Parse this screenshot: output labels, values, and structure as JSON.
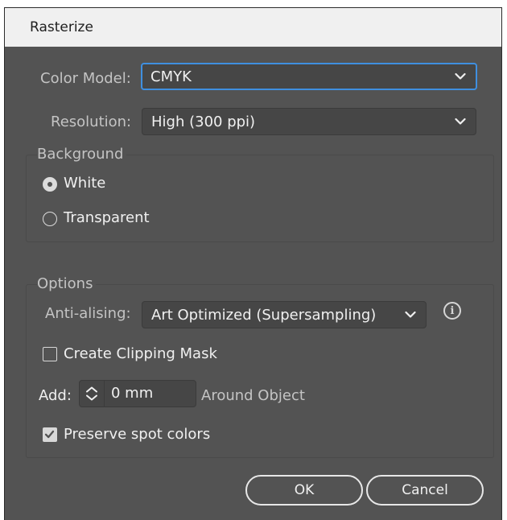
{
  "dialog": {
    "title": "Rasterize",
    "color_model": {
      "label": "Color Model:",
      "value": "CMYK"
    },
    "resolution": {
      "label": "Resolution:",
      "value": "High (300 ppi)"
    },
    "background": {
      "title": "Background",
      "options": [
        "White",
        "Transparent"
      ],
      "selected": "White"
    },
    "options": {
      "title": "Options",
      "anti_aliasing": {
        "label": "Anti-alising:",
        "value": "Art Optimized (Supersampling)"
      },
      "create_clipping_mask": {
        "label": "Create Clipping Mask",
        "checked": false
      },
      "add": {
        "label": "Add:",
        "value": "0 mm",
        "suffix": "Around Object"
      },
      "preserve_spot_colors": {
        "label": "Preserve spot colors",
        "checked": true
      }
    },
    "buttons": {
      "ok": "OK",
      "cancel": "Cancel"
    }
  },
  "icons": {
    "info": "info-icon",
    "dropdown": "chevron-down-icon",
    "stepper": "stepper-arrows-icon",
    "checkmark": "checkmark-icon"
  },
  "colors": {
    "panel": "#535353",
    "titlebar": "#f0f0f0",
    "focus": "#3f8fe0"
  }
}
